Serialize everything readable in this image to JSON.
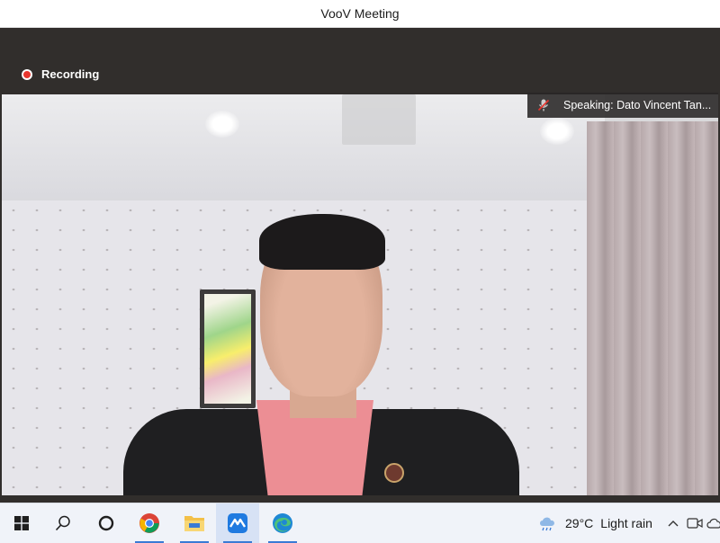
{
  "window": {
    "title": "VooV Meeting"
  },
  "meeting": {
    "recording_label": "Recording",
    "speaking_label": "Speaking: Dato Vincent Tan..."
  },
  "taskbar": {
    "icons": [
      "windows-start-icon",
      "search-icon",
      "cortana-icon",
      "chrome-icon",
      "file-explorer-icon",
      "voov-meeting-icon",
      "edge-icon"
    ],
    "weather": {
      "temperature": "29°C",
      "condition": "Light rain"
    }
  },
  "colors": {
    "recording_red": "#e8362e",
    "titlebar_bg": "#ffffff",
    "window_bg": "#312e2c",
    "taskbar_bg": "#f0f3f9",
    "accent_blue": "#3a7bd5"
  }
}
